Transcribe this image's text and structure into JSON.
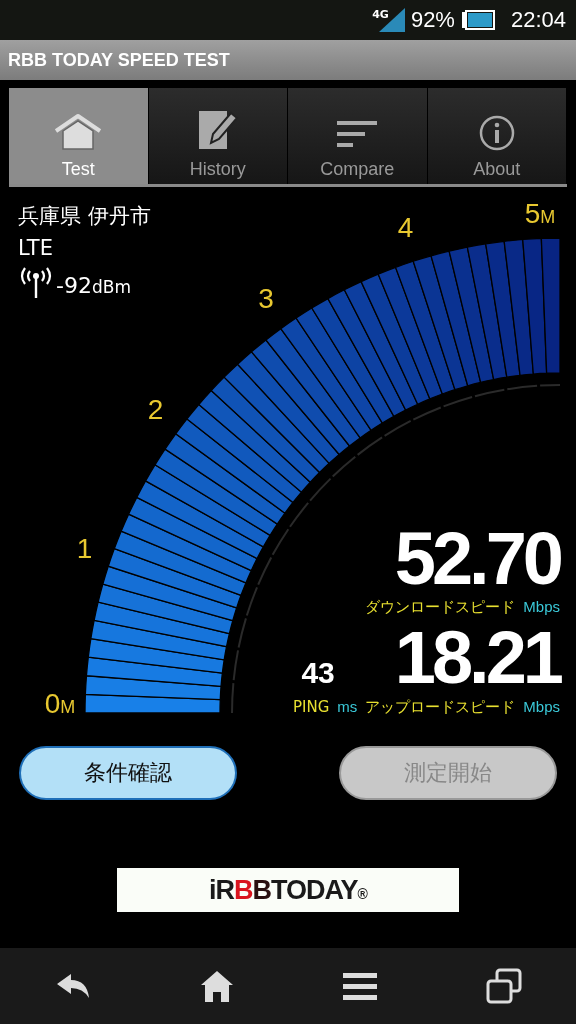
{
  "status_bar": {
    "network": "4G",
    "battery": "92%",
    "time": "22:04"
  },
  "app_bar": {
    "title": "RBB TODAY SPEED TEST"
  },
  "tabs": [
    {
      "label": "Test",
      "kind": "home",
      "selected": true
    },
    {
      "label": "History",
      "kind": "notepad",
      "selected": false
    },
    {
      "label": "Compare",
      "kind": "lines",
      "selected": false
    },
    {
      "label": "About",
      "kind": "info",
      "selected": false
    }
  ],
  "location": {
    "place": "兵庫県 伊丹市",
    "network_type": "LTE",
    "signal": {
      "value": "-92",
      "unit": "dBm"
    }
  },
  "gauge": {
    "ticks": [
      {
        "value": "0",
        "unit": "M"
      },
      {
        "value": "1"
      },
      {
        "value": "2"
      },
      {
        "value": "3"
      },
      {
        "value": "4"
      },
      {
        "value": "5",
        "unit": "M"
      }
    ]
  },
  "results": {
    "download": {
      "value": "52.70",
      "label": "ダウンロードスピード",
      "unit": "Mbps"
    },
    "upload": {
      "value": "18.21",
      "label": "アップロードスピード",
      "unit": "Mbps"
    },
    "ping": {
      "value": "43",
      "label": "PING",
      "unit": "ms"
    }
  },
  "buttons": [
    {
      "label": "条件確認",
      "disabled": false
    },
    {
      "label": "測定開始",
      "disabled": true
    }
  ],
  "banner": {
    "logo": [
      {
        "text": "iR",
        "color": "#1a1a1a"
      },
      {
        "text": "B",
        "color": "#d9141e"
      },
      {
        "text": "B",
        "color": "#2a1010"
      },
      {
        "text": "TODAY",
        "color": "#1a1a1a"
      },
      {
        "text": "®",
        "color": "#1a1a1a"
      }
    ]
  },
  "nav_buttons": [
    {
      "kind": "back"
    },
    {
      "kind": "home"
    },
    {
      "kind": "menu"
    },
    {
      "kind": "recent"
    }
  ]
}
